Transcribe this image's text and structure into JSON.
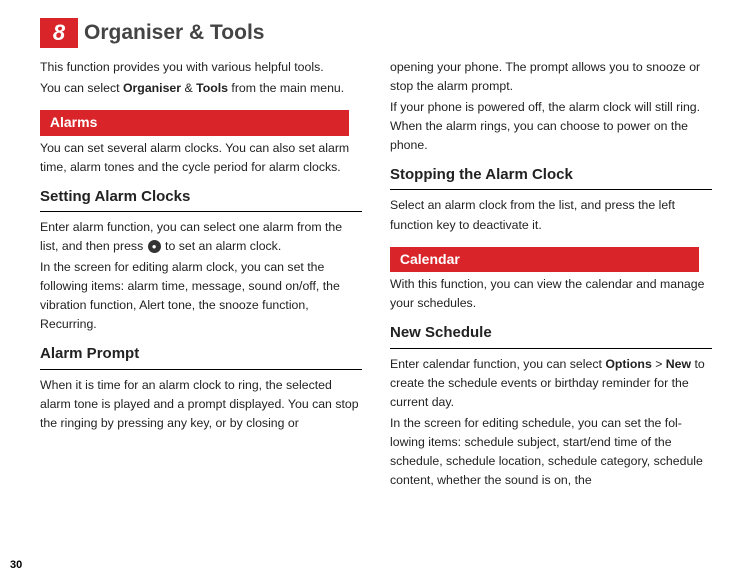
{
  "chapter": {
    "number": "8",
    "title": "Organiser & Tools"
  },
  "pageNumber": "30",
  "col1": {
    "intro_p1": "This function provides you with various helpful tools.",
    "intro_p2a": "You can select ",
    "intro_bold1": "Organiser",
    "intro_amp": " & ",
    "intro_bold2": "Tools",
    "intro_p2b": " from the main menu.",
    "alarms_label": "Alarms",
    "alarms_p1": "You can set several alarm clocks. You can also set alarm time, alarm tones and the cycle period for alarm clocks.",
    "h_setting": "Setting Alarm Clocks",
    "setting_p1a": "Enter alarm function, you can select one alarm from the list, and then press ",
    "setting_p1b": " to set an alarm clock.",
    "setting_p2": "In the screen for editing alarm clock, you can set the following items: alarm time, message, sound on/off, the vibration function, Alert tone, the snooze function, Recurring.",
    "h_prompt": "Alarm Prompt",
    "prompt_p1": "When it is time for an alarm clock to ring, the selected alarm tone is played and a prompt displayed. You can stop the ringing by pressing any key, or by closing or"
  },
  "col2": {
    "cont_p1": "opening your phone. The prompt allows you to snooze or stop the alarm prompt.",
    "cont_p2": "If your phone is powered off, the alarm clock will still ring. When the alarm rings, you can choose to power on the phone.",
    "h_stopping": "Stopping the Alarm Clock",
    "stopping_p1": "Select an alarm clock from the list, and press the left function key to deactivate it.",
    "calendar_label": "Calendar",
    "calendar_p1": "With this function, you can view the calendar and manage your schedules.",
    "h_newsched": "New Schedule",
    "newsched_p1a": "Enter calendar function, you can select ",
    "newsched_bold1": "Options",
    "newsched_gt": " > ",
    "newsched_bold2": "New",
    "newsched_p1b": " to create the schedule events or birthday reminder for the current day.",
    "newsched_p2": "In the screen for editing schedule, you can set the fol-lowing items: schedule subject, start/end time of the schedule, schedule location, schedule category, schedule content,  whether the sound is on, the"
  }
}
